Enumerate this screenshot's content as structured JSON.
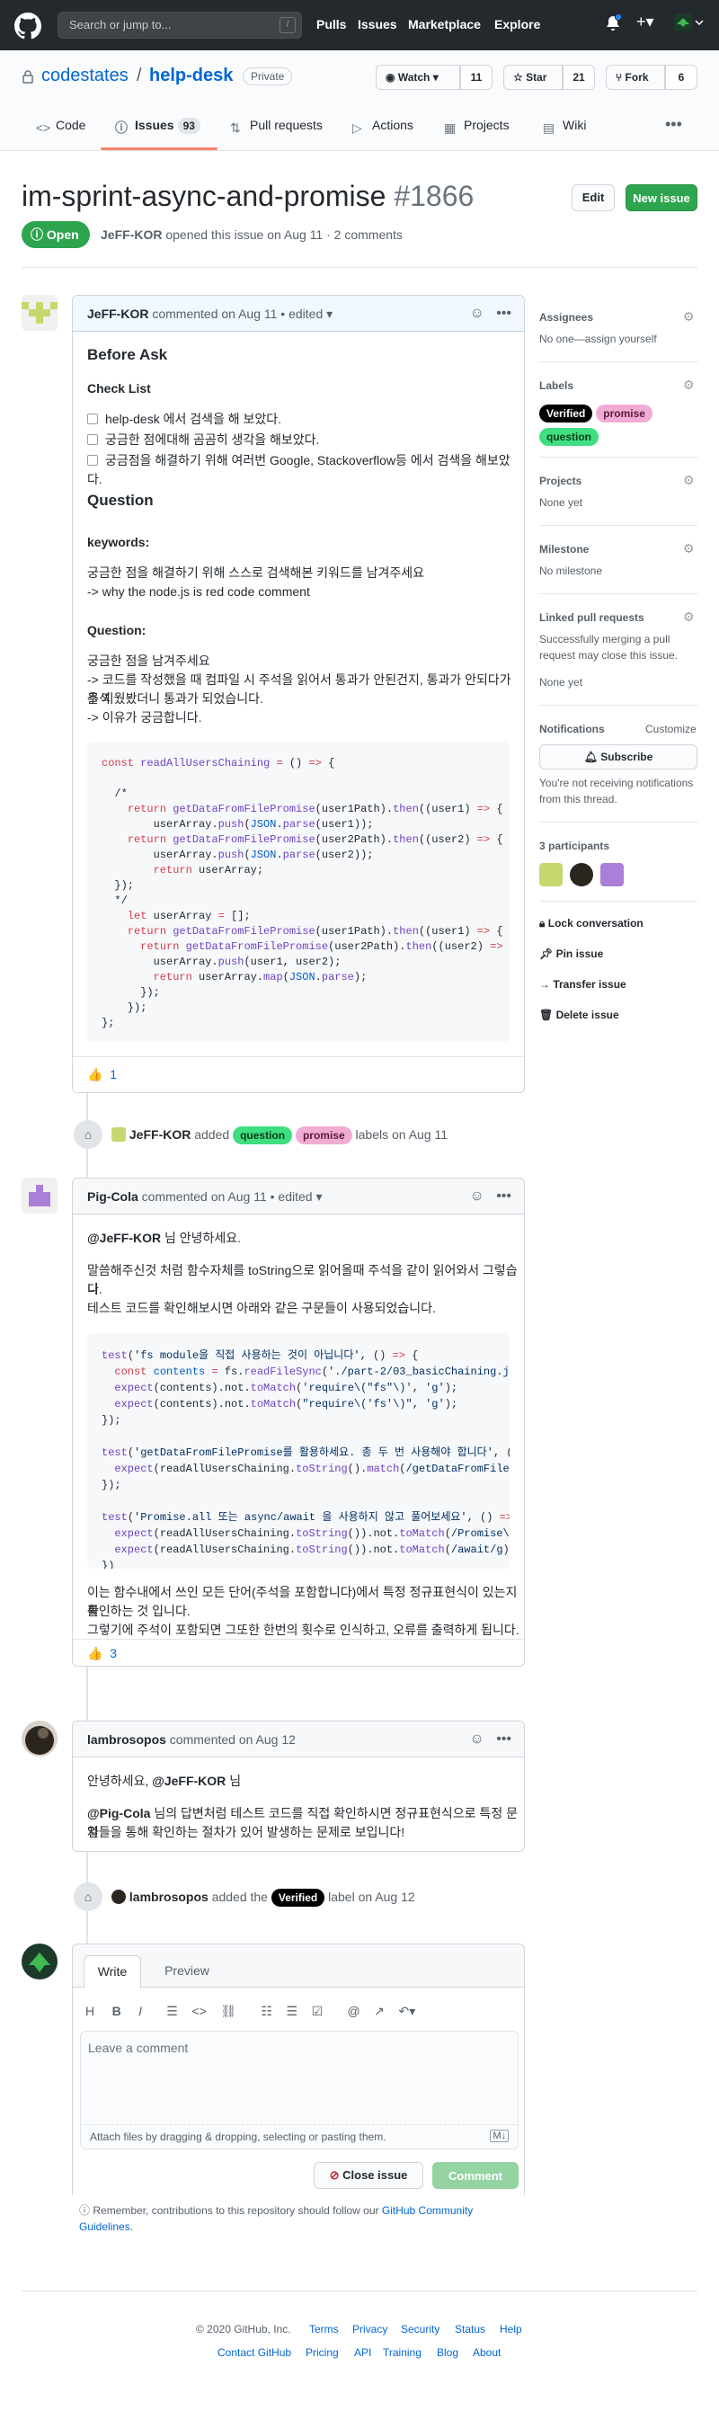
{
  "header": {
    "search_placeholder": "Search or jump to...",
    "search_key": "/",
    "nav": [
      "Pulls",
      "Issues",
      "Marketplace",
      "Explore"
    ]
  },
  "repo": {
    "owner": "codestates",
    "sep": "/",
    "name": "help-desk",
    "visibility": "Private",
    "watch_label": "Watch",
    "watch_count": "11",
    "star_label": "Star",
    "star_count": "21",
    "fork_label": "Fork",
    "fork_count": "6",
    "tabs": [
      {
        "label": "Code"
      },
      {
        "label": "Issues",
        "count": "93"
      },
      {
        "label": "Pull requests"
      },
      {
        "label": "Actions"
      },
      {
        "label": "Projects"
      },
      {
        "label": "Wiki"
      }
    ]
  },
  "issue": {
    "title": "im-sprint-async-and-promise",
    "number": "#1866",
    "edit_label": "Edit",
    "new_issue_label": "New issue",
    "state": "Open",
    "author": "JeFF-KOR",
    "meta": "opened this issue on Aug 11 · 2 comments"
  },
  "comment1": {
    "author": "JeFF-KOR",
    "meta": "commented on Aug 11 • edited",
    "before_ask": "Before Ask",
    "checklist_title": "Check List",
    "checklist": [
      "help-desk 에서 검색을 해 보았다.",
      "궁금한 점에대해 곰곰히 생각을 해보았다.",
      "궁금점을 해결하기 위해 여러번 Google, Stackoverflow등 에서 검색을 해보았다."
    ],
    "question_title": "Question",
    "keywords_title": "keywords:",
    "keywords_lines": [
      "궁금한 점을 해결하기 위해 스스로 검색해본 키워드를 남겨주세요",
      "-> why the node.js is red code comment"
    ],
    "question_label": "Question:",
    "question_lines": [
      "궁금한 점을 남겨주세요",
      "-> 코드를 작성했을 때 컴파일 시 주석을 읽어서 통과가 안된건지, 통과가 안되다가 주석",
      "을 지웠봤더니 통과가 되었습니다.",
      "-> 이유가 궁금합니다."
    ],
    "reaction_emoji": "👍",
    "reaction_count": "1"
  },
  "event1": {
    "actor": "JeFF-KOR",
    "verb": "added",
    "labels": [
      "question",
      "promise"
    ],
    "suffix": "labels on Aug 11"
  },
  "comment2": {
    "author": "Pig-Cola",
    "meta": "commented on Aug 11 • edited",
    "mention": "@JeFF-KOR",
    "greeting": "님 안녕하세요.",
    "para1": [
      "말씀해주신것 처럼 함수자체를 toString으로 읽어올때 주석을 같이 읽어와서 그렇습니",
      "다.",
      "테스트 코드를 확인해보시면 아래와 같은 구문들이 사용되었습니다."
    ],
    "para2": [
      "이는 함수내에서 쓰인 모든 단어(주석을 포함합니다)에서 특정 정규표현식이 있는지를",
      "확인하는 것 입니다.",
      "그렇기에 주석이 포함되면 그또한 한번의 횟수로 인식하고, 오류를 출력하게 됩니다."
    ],
    "reaction_emoji": "👍",
    "reaction_count": "3"
  },
  "comment3": {
    "author": "lambrosopos",
    "meta": "commented on Aug 12",
    "line1_prefix": "안녕하세요,",
    "line1_mention": "@JeFF-KOR",
    "line1_suffix": "님",
    "line2_mention": "@Pig-Cola",
    "line2_text": "님의 답변처럼 테스트 코드를 직접 확인하시면 정규표현식으로 특정 문자",
    "line3": "열들을 통해 확인하는 절차가 있어 발생하는 문제로 보입니다!"
  },
  "event2": {
    "actor": "lambrosopos",
    "verb": "added the",
    "label": "Verified",
    "suffix": "label on Aug 12"
  },
  "compose": {
    "tab_write": "Write",
    "tab_preview": "Preview",
    "placeholder": "Leave a comment",
    "attach_hint": "Attach files by dragging & dropping, selecting or pasting them.",
    "close_issue_label": "Close issue",
    "comment_label": "Comment",
    "remember_prefix": "Remember, contributions to this repository should follow our",
    "remember_link": "GitHub Community Guidelines",
    "remember_suffix": "."
  },
  "sidebar": {
    "assignees_title": "Assignees",
    "assignees_value": "No one—assign yourself",
    "labels_title": "Labels",
    "labels": [
      "Verified",
      "promise",
      "question"
    ],
    "projects_title": "Projects",
    "projects_value": "None yet",
    "milestone_title": "Milestone",
    "milestone_value": "No milestone",
    "linked_title": "Linked pull requests",
    "linked_desc_1": "Successfully merging a pull",
    "linked_desc_2": "request may close this issue.",
    "linked_value": "None yet",
    "notifications_title": "Notifications",
    "customize_label": "Customize",
    "subscribe_label": "Subscribe",
    "notif_desc_1": "You're not receiving notifications",
    "notif_desc_2": "from this thread.",
    "participants_title": "3 participants",
    "lock_label": "Lock conversation",
    "pin_label": "Pin issue",
    "transfer_label": "Transfer issue",
    "delete_label": "Delete issue"
  },
  "footer": {
    "copyright": "© 2020 GitHub, Inc.",
    "row1": [
      "Terms",
      "Privacy",
      "Security",
      "Status",
      "Help"
    ],
    "row2": [
      "Contact GitHub",
      "Pricing",
      "API",
      "Training",
      "Blog",
      "About"
    ]
  }
}
